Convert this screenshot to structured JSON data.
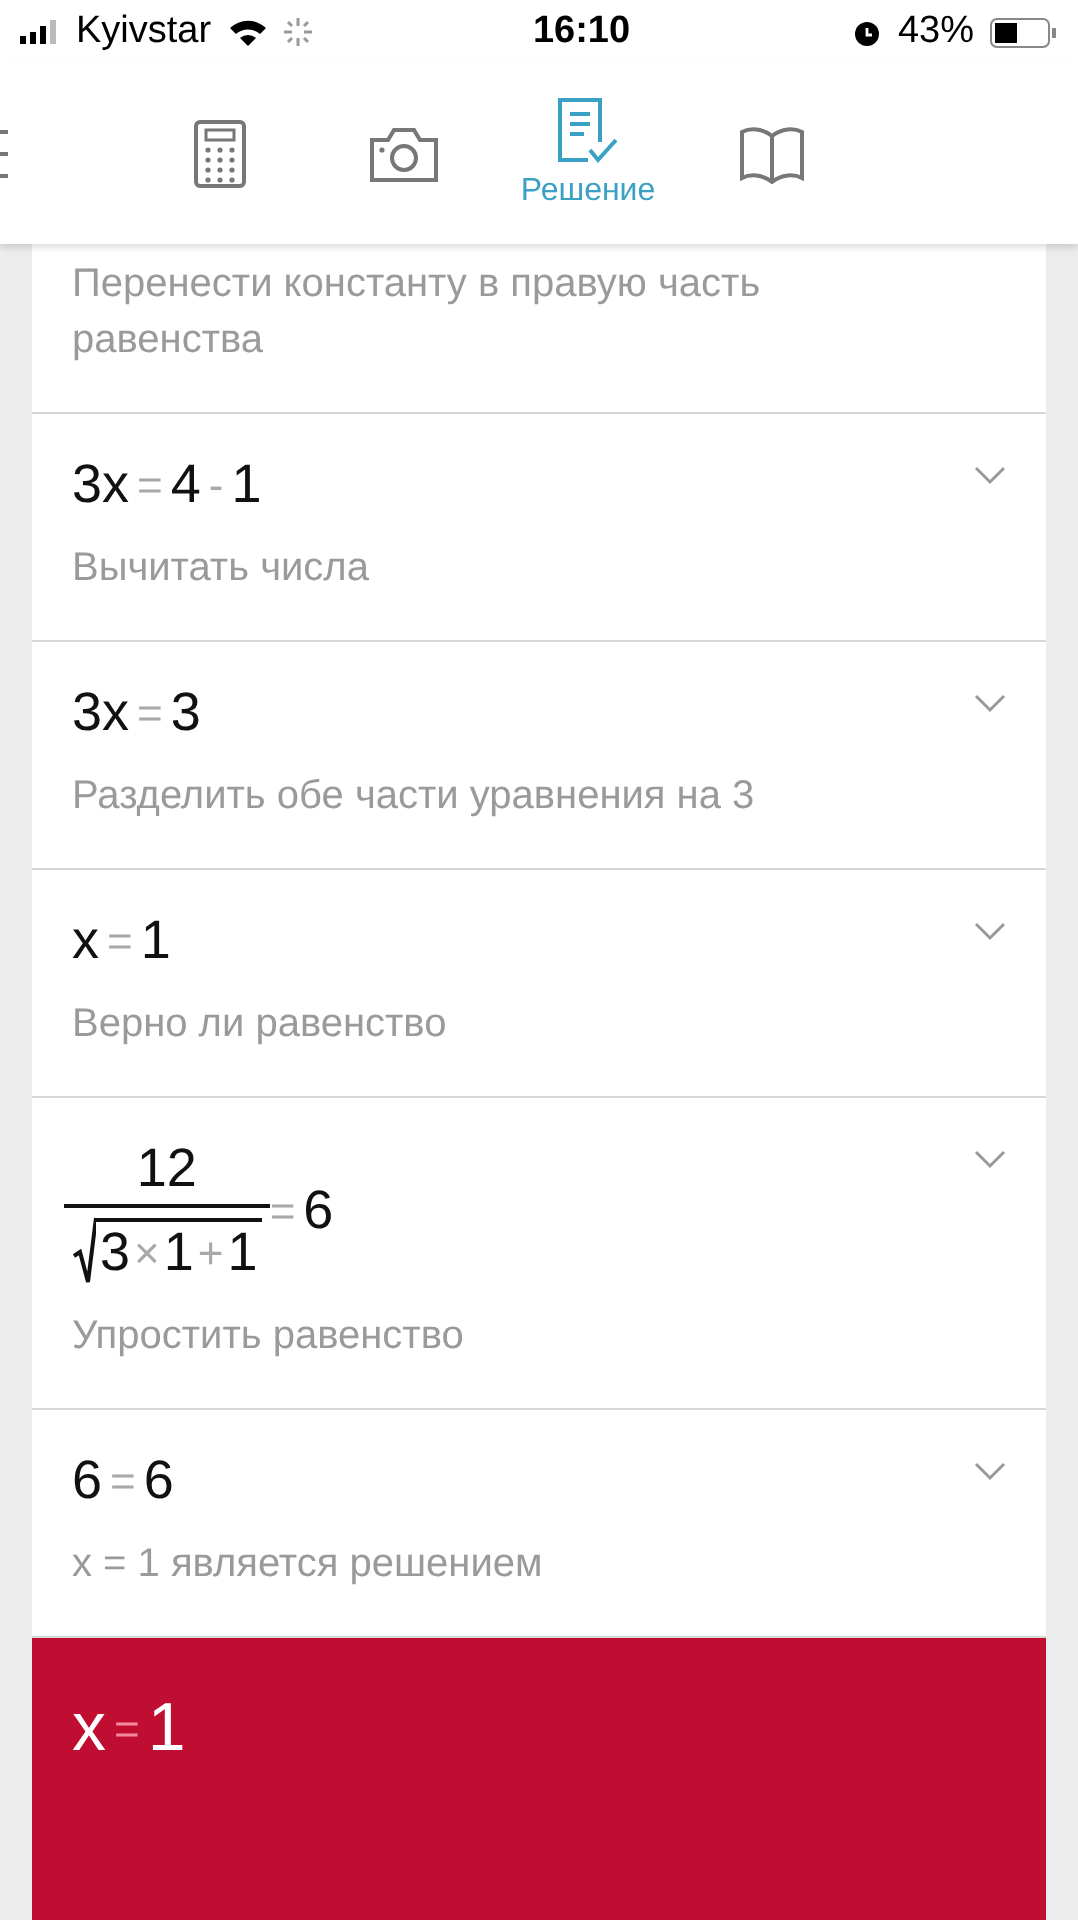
{
  "status_bar": {
    "carrier": "Kyivstar",
    "time": "16:10",
    "battery": "43%"
  },
  "tabs": [
    {
      "kind": "menu",
      "selected": false
    },
    {
      "kind": "calculator",
      "selected": false
    },
    {
      "kind": "camera",
      "selected": false
    },
    {
      "kind": "solution",
      "selected": true,
      "label": "Решение"
    },
    {
      "kind": "book",
      "selected": false
    }
  ],
  "steps": [
    {
      "description": "Перенести константу в правую часть равенства"
    },
    {
      "equation": [
        {
          "kind": "term",
          "text": "3x"
        },
        {
          "kind": "op",
          "text": "="
        },
        {
          "kind": "term",
          "text": "4"
        },
        {
          "kind": "op",
          "text": "-"
        },
        {
          "kind": "term",
          "text": "1"
        }
      ],
      "description": "Вычитать числа",
      "expanded": false
    },
    {
      "equation": [
        {
          "kind": "term",
          "text": "3x"
        },
        {
          "kind": "op",
          "text": "="
        },
        {
          "kind": "term",
          "text": "3"
        }
      ],
      "description": "Разделить обе части уравнения на 3",
      "expanded": false
    },
    {
      "equation": [
        {
          "kind": "term",
          "text": "x"
        },
        {
          "kind": "op",
          "text": "="
        },
        {
          "kind": "term",
          "text": "1"
        }
      ],
      "description": "Верно ли равенство",
      "expanded": false
    },
    {
      "equation": [
        {
          "kind": "fraction",
          "numerator": "12",
          "radicand": [
            {
              "kind": "term",
              "text": "3"
            },
            {
              "kind": "op",
              "text": "×"
            },
            {
              "kind": "term",
              "text": "1"
            },
            {
              "kind": "op",
              "text": "+"
            },
            {
              "kind": "term",
              "text": "1"
            }
          ]
        },
        {
          "kind": "op",
          "text": "="
        },
        {
          "kind": "term",
          "text": "6"
        }
      ],
      "description": "Упростить равенство",
      "expanded": false
    },
    {
      "equation": [
        {
          "kind": "term",
          "text": "6"
        },
        {
          "kind": "op",
          "text": "="
        },
        {
          "kind": "term",
          "text": "6"
        }
      ],
      "description": "x = 1 является решением",
      "expanded": false
    }
  ],
  "result": [
    {
      "kind": "term",
      "text": "x"
    },
    {
      "kind": "op",
      "text": "="
    },
    {
      "kind": "term",
      "text": "1"
    }
  ]
}
